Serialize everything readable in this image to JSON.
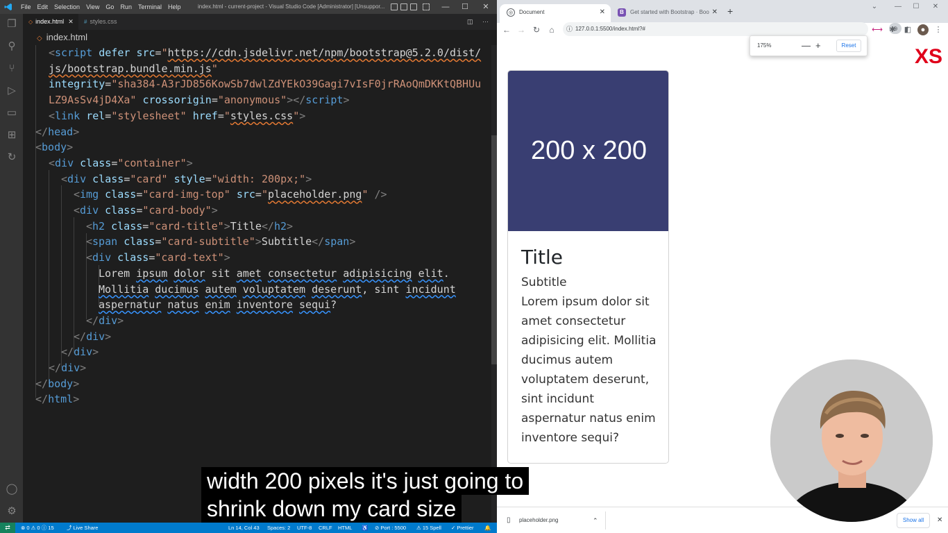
{
  "vscode": {
    "menus": [
      "File",
      "Edit",
      "Selection",
      "View",
      "Go",
      "Run",
      "Terminal",
      "Help"
    ],
    "window_title": "index.html - current-project - Visual Studio Code [Administrator] [Unsuppor...",
    "tabs": [
      {
        "label": "index.html",
        "active": true
      },
      {
        "label": "styles.css",
        "active": false
      }
    ],
    "breadcrumb": "index.html",
    "status": {
      "problems": "⊗ 0 ⚠ 0 ⓘ 15",
      "live_share": "Live Share",
      "position": "Ln 14, Col 43",
      "spaces": "Spaces: 2",
      "encoding": "UTF-8",
      "eol": "CRLF",
      "language": "HTML",
      "port": "Port : 5500",
      "spell": "15 Spell",
      "prettier": "Prettier"
    }
  },
  "code_lines": [
    [
      [
        "w",
        "  "
      ],
      [
        "p",
        "<"
      ],
      [
        "t",
        "script"
      ],
      [
        "w",
        " "
      ],
      [
        "a",
        "defer"
      ],
      [
        "w",
        " "
      ],
      [
        "a",
        "src"
      ],
      [
        "w",
        "="
      ],
      [
        "s",
        "\""
      ],
      [
        "us",
        "https://cdn.jsdelivr.net/npm/bootstrap@5.2.0/dist/"
      ]
    ],
    [
      [
        "us",
        "  js/bootstrap.bundle.min.js"
      ],
      [
        "s",
        "\""
      ]
    ],
    [
      [
        "w",
        "  "
      ],
      [
        "a",
        "integrity"
      ],
      [
        "w",
        "="
      ],
      [
        "s",
        "\"sha384-A3rJD856KowSb7dwlZdYEkO39Gagi7vIsF0jrRAoQmDKKtQBHUu"
      ]
    ],
    [
      [
        "s",
        "  LZ9AsSv4jD4Xa\""
      ],
      [
        "w",
        " "
      ],
      [
        "a",
        "crossorigin"
      ],
      [
        "w",
        "="
      ],
      [
        "s",
        "\"anonymous\""
      ],
      [
        "p",
        "></"
      ],
      [
        "t",
        "script"
      ],
      [
        "p",
        ">"
      ]
    ],
    [
      [
        "w",
        "  "
      ],
      [
        "p",
        "<"
      ],
      [
        "t",
        "link"
      ],
      [
        "w",
        " "
      ],
      [
        "a",
        "rel"
      ],
      [
        "w",
        "="
      ],
      [
        "s",
        "\"stylesheet\""
      ],
      [
        "w",
        " "
      ],
      [
        "a",
        "href"
      ],
      [
        "w",
        "="
      ],
      [
        "s",
        "\""
      ],
      [
        "us",
        "styles.css"
      ],
      [
        "s",
        "\""
      ],
      [
        "p",
        ">"
      ]
    ],
    [
      [
        "p",
        "</"
      ],
      [
        "t",
        "head"
      ],
      [
        "p",
        ">"
      ]
    ],
    [
      [
        "p",
        "<"
      ],
      [
        "t",
        "body"
      ],
      [
        "p",
        ">"
      ]
    ],
    [
      [
        "w",
        "  "
      ],
      [
        "p",
        "<"
      ],
      [
        "t",
        "div"
      ],
      [
        "w",
        " "
      ],
      [
        "a",
        "class"
      ],
      [
        "w",
        "="
      ],
      [
        "s",
        "\"container\""
      ],
      [
        "p",
        ">"
      ]
    ],
    [
      [
        "w",
        "    "
      ],
      [
        "p",
        "<"
      ],
      [
        "t",
        "div"
      ],
      [
        "w",
        " "
      ],
      [
        "a",
        "class"
      ],
      [
        "w",
        "="
      ],
      [
        "s",
        "\"card\""
      ],
      [
        "w",
        " "
      ],
      [
        "a",
        "style"
      ],
      [
        "w",
        "="
      ],
      [
        "s",
        "\"width: 200px;\""
      ],
      [
        "p",
        ">"
      ]
    ],
    [
      [
        "w",
        "      "
      ],
      [
        "p",
        "<"
      ],
      [
        "t",
        "img"
      ],
      [
        "w",
        " "
      ],
      [
        "a",
        "class"
      ],
      [
        "w",
        "="
      ],
      [
        "s",
        "\"card-img-top\""
      ],
      [
        "w",
        " "
      ],
      [
        "a",
        "src"
      ],
      [
        "w",
        "="
      ],
      [
        "s",
        "\""
      ],
      [
        "us",
        "placeholder.png"
      ],
      [
        "s",
        "\""
      ],
      [
        "w",
        " "
      ],
      [
        "p",
        "/>"
      ]
    ],
    [
      [
        "w",
        "      "
      ],
      [
        "p",
        "<"
      ],
      [
        "t",
        "div"
      ],
      [
        "w",
        " "
      ],
      [
        "a",
        "class"
      ],
      [
        "w",
        "="
      ],
      [
        "s",
        "\"card-body\""
      ],
      [
        "p",
        ">"
      ]
    ],
    [
      [
        "w",
        "        "
      ],
      [
        "p",
        "<"
      ],
      [
        "t",
        "h2"
      ],
      [
        "w",
        " "
      ],
      [
        "a",
        "class"
      ],
      [
        "w",
        "="
      ],
      [
        "s",
        "\"card-title\""
      ],
      [
        "p",
        ">"
      ],
      [
        "w",
        "Title"
      ],
      [
        "p",
        "</"
      ],
      [
        "t",
        "h2"
      ],
      [
        "p",
        ">"
      ]
    ],
    [
      [
        "w",
        "        "
      ],
      [
        "p",
        "<"
      ],
      [
        "t",
        "span"
      ],
      [
        "w",
        " "
      ],
      [
        "a",
        "class"
      ],
      [
        "w",
        "="
      ],
      [
        "s",
        "\"card-subtitle\""
      ],
      [
        "p",
        ">"
      ],
      [
        "w",
        "Subtitle"
      ],
      [
        "p",
        "</"
      ],
      [
        "t",
        "span"
      ],
      [
        "p",
        ">"
      ]
    ],
    [
      [
        "w",
        "        "
      ],
      [
        "p",
        "<"
      ],
      [
        "t",
        "div"
      ],
      [
        "w",
        " "
      ],
      [
        "a",
        "class"
      ],
      [
        "w",
        "="
      ],
      [
        "s",
        "\"card-text\""
      ],
      [
        "p",
        ">"
      ]
    ],
    [
      [
        "w",
        "          Lorem "
      ],
      [
        "u",
        "ipsum"
      ],
      [
        "w",
        " "
      ],
      [
        "u",
        "dolor"
      ],
      [
        "w",
        " sit "
      ],
      [
        "u",
        "amet"
      ],
      [
        "w",
        " "
      ],
      [
        "u",
        "consectetur"
      ],
      [
        "w",
        " "
      ],
      [
        "u",
        "adipisicing"
      ],
      [
        "w",
        " "
      ],
      [
        "u",
        "elit"
      ],
      [
        "w",
        "."
      ]
    ],
    [
      [
        "w",
        "          "
      ],
      [
        "u",
        "Mollitia"
      ],
      [
        "w",
        " "
      ],
      [
        "u",
        "ducimus"
      ],
      [
        "w",
        " "
      ],
      [
        "u",
        "autem"
      ],
      [
        "w",
        " "
      ],
      [
        "u",
        "voluptatem"
      ],
      [
        "w",
        " "
      ],
      [
        "u",
        "deserunt"
      ],
      [
        "w",
        ", sint "
      ],
      [
        "u",
        "incidunt"
      ]
    ],
    [
      [
        "w",
        "          "
      ],
      [
        "u",
        "aspernatur"
      ],
      [
        "w",
        " "
      ],
      [
        "u",
        "natus"
      ],
      [
        "w",
        " "
      ],
      [
        "u",
        "enim"
      ],
      [
        "w",
        " "
      ],
      [
        "u",
        "inventore"
      ],
      [
        "w",
        " "
      ],
      [
        "u",
        "sequi"
      ],
      [
        "w",
        "?"
      ]
    ],
    [
      [
        "w",
        "        "
      ],
      [
        "p",
        "</"
      ],
      [
        "t",
        "div"
      ],
      [
        "p",
        ">"
      ]
    ],
    [
      [
        "w",
        "      "
      ],
      [
        "p",
        "</"
      ],
      [
        "t",
        "div"
      ],
      [
        "p",
        ">"
      ]
    ],
    [
      [
        "w",
        "    "
      ],
      [
        "p",
        "</"
      ],
      [
        "t",
        "div"
      ],
      [
        "p",
        ">"
      ]
    ],
    [
      [
        "w",
        "  "
      ],
      [
        "p",
        "</"
      ],
      [
        "t",
        "div"
      ],
      [
        "p",
        ">"
      ]
    ],
    [
      [
        "p",
        "</"
      ],
      [
        "t",
        "body"
      ],
      [
        "p",
        ">"
      ]
    ],
    [
      [
        "p",
        "</"
      ],
      [
        "t",
        "html"
      ],
      [
        "p",
        ">"
      ]
    ]
  ],
  "browser": {
    "tabs": [
      {
        "title": "Document",
        "favicon": "globe-icon",
        "active": true
      },
      {
        "title": "Get started with Bootstrap · Boo",
        "favicon": "B",
        "active": false
      }
    ],
    "url": "127.0.0.1:5500/index.html?#",
    "zoom": "175%",
    "reset_label": "Reset",
    "breakpoint_label": "XS",
    "card": {
      "image_text": "200 x 200",
      "image_color": "#393e72",
      "title": "Title",
      "subtitle": "Subtitle",
      "text": "Lorem ipsum dolor sit amet consectetur adipisicing elit. Mollitia ducimus autem voluptatem deserunt, sint incidunt aspernatur natus enim inventore sequi?"
    },
    "download": {
      "filename": "placeholder.png",
      "show_all": "Show all"
    }
  },
  "caption": {
    "line1": "width 200 pixels it's just going to",
    "line2": "shrink down my card size"
  }
}
